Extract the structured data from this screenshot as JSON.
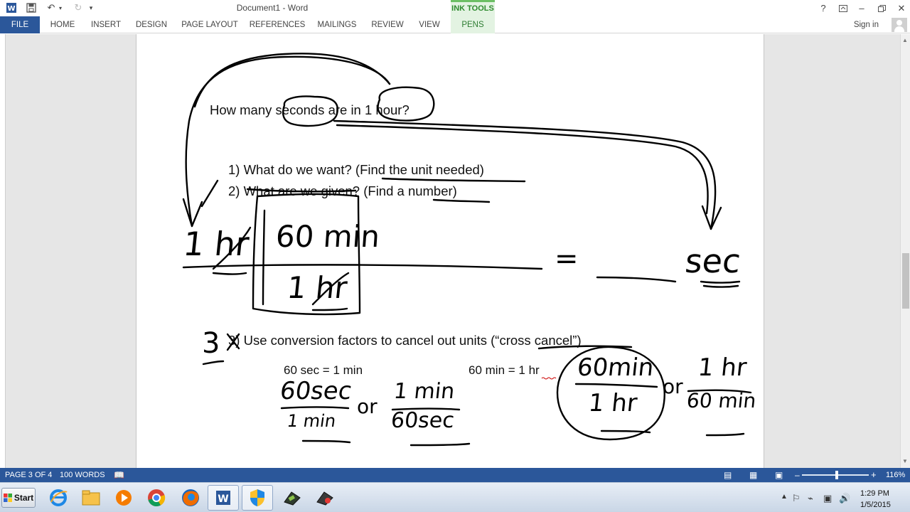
{
  "window": {
    "title": "Document1 - Word",
    "contextual_group": "INK TOOLS",
    "signin": "Sign in"
  },
  "ribbon": {
    "tabs": [
      {
        "label": "FILE"
      },
      {
        "label": "HOME"
      },
      {
        "label": "INSERT"
      },
      {
        "label": "DESIGN"
      },
      {
        "label": "PAGE LAYOUT"
      },
      {
        "label": "REFERENCES"
      },
      {
        "label": "MAILINGS"
      },
      {
        "label": "REVIEW"
      },
      {
        "label": "VIEW"
      },
      {
        "label": "PENS"
      }
    ]
  },
  "document": {
    "question": "How many seconds are in 1 hour?",
    "step1": "1)  What do we want? (Find the unit needed)",
    "step2": "2)  What are we given? (Find a number)",
    "step3": "3)  Use conversion factors to cancel out units (“cross cancel”)",
    "fact1": "60 sec = 1 min",
    "fact2": "60 min = 1 hr",
    "handwriting": {
      "given": "1 hr",
      "factor_top": "60 min",
      "factor_bottom": "1 hr",
      "equals": "=",
      "result_unit": "sec",
      "step_mark": "3",
      "frac1_top": "60sec",
      "frac1_bottom": "1 min",
      "or1": "or",
      "frac2_top": "1 min",
      "frac2_bottom": "60sec",
      "frac3_top": "60min",
      "frac3_bottom": "1 hr",
      "or2": "or",
      "frac4_top": "1 hr",
      "frac4_bottom": "60 min"
    }
  },
  "status": {
    "page": "PAGE 3 OF 4",
    "words": "100 WORDS",
    "zoom": "116%",
    "zoom_level": 1.16
  },
  "taskbar": {
    "start": "Start",
    "time": "1:29 PM",
    "date": "1/5/2015"
  },
  "colors": {
    "word_blue": "#2b579a",
    "ink_green": "#6cbf64"
  }
}
